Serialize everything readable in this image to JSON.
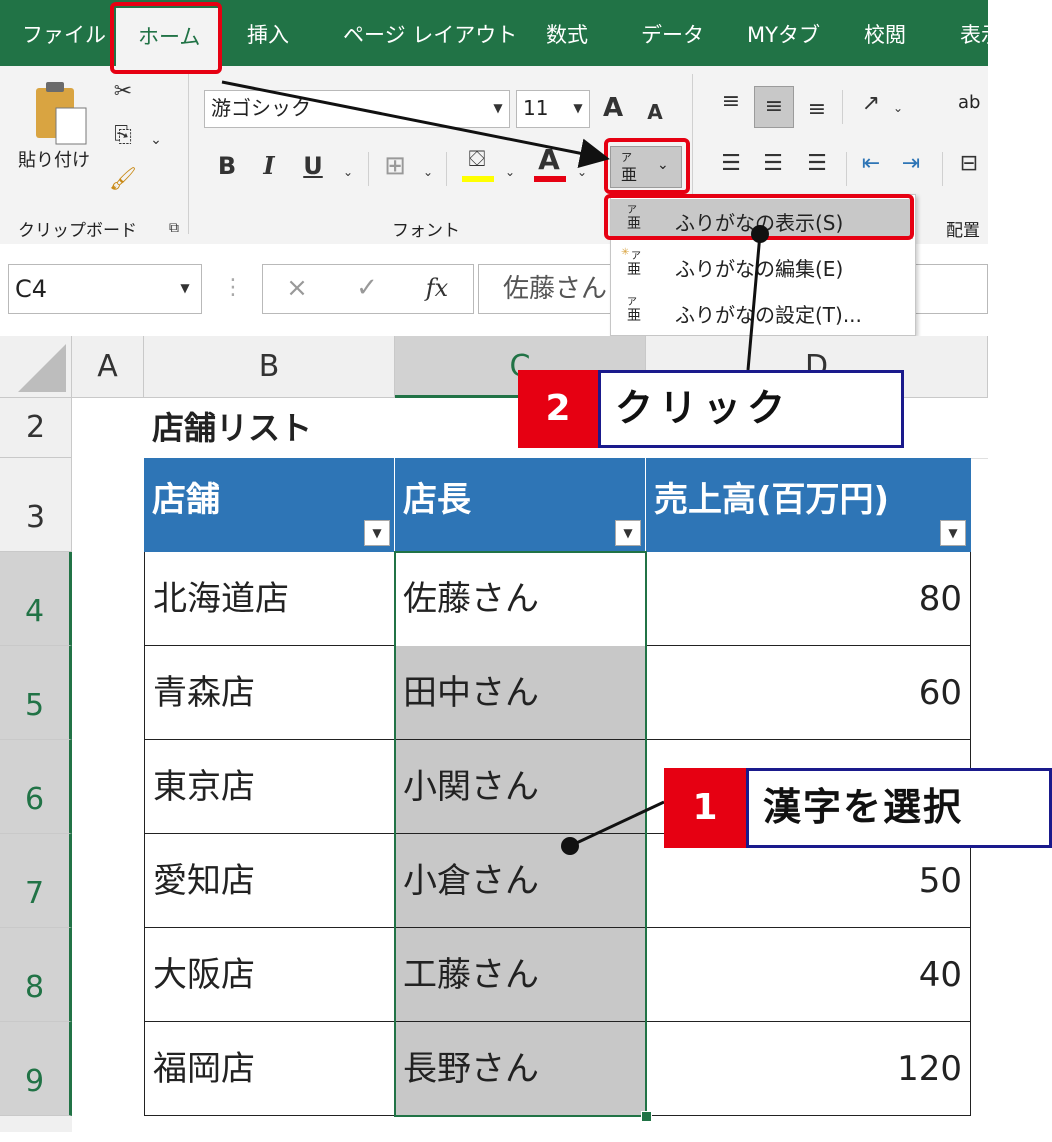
{
  "ribbon": {
    "tabs": [
      "ファイル",
      "ホーム",
      "挿入",
      "ページ レイアウト",
      "数式",
      "データ",
      "MYタブ",
      "校閲",
      "表示"
    ],
    "paste_label": "貼り付け",
    "clipboard_group": "クリップボード",
    "font_group": "フォント",
    "align_group": "配置",
    "font_name": "游ゴシック",
    "font_size": "11",
    "bold": "B",
    "italic": "I",
    "underline": "U",
    "grow_font": "A",
    "shrink_font": "A",
    "font_color": "A",
    "wrap_text": "ab"
  },
  "phonetic_menu": {
    "items": [
      "ふりがなの表示(S)",
      "ふりがなの編集(E)",
      "ふりがなの設定(T)..."
    ]
  },
  "formula_bar": {
    "name_box": "C4",
    "fx": "fx",
    "cancel": "×",
    "enter": "✓",
    "value": "佐藤さん"
  },
  "sheet": {
    "columns": [
      "A",
      "B",
      "C",
      "D"
    ],
    "rows": [
      "2",
      "3",
      "4",
      "5",
      "6",
      "7",
      "8",
      "9"
    ],
    "title": "店舗リスト",
    "headers": [
      "店舗",
      "店長",
      "売上高(百万円)"
    ],
    "data": [
      {
        "store": "北海道店",
        "manager": "佐藤さん",
        "sales": "80"
      },
      {
        "store": "青森店",
        "manager": "田中さん",
        "sales": "60"
      },
      {
        "store": "東京店",
        "manager": "小関さん",
        "sales": ""
      },
      {
        "store": "愛知店",
        "manager": "小倉さん",
        "sales": "50"
      },
      {
        "store": "大阪店",
        "manager": "工藤さん",
        "sales": "40"
      },
      {
        "store": "福岡店",
        "manager": "長野さん",
        "sales": "120"
      }
    ]
  },
  "callouts": {
    "step1_num": "1",
    "step1_text": "漢字を選択",
    "step2_num": "2",
    "step2_text": "クリック"
  },
  "colors": {
    "excel_green": "#217346",
    "header_blue": "#2e75b6",
    "selection_gray": "#c8c8c8",
    "annotation_red": "#e60012",
    "annotation_navy": "#1a1a8c"
  }
}
